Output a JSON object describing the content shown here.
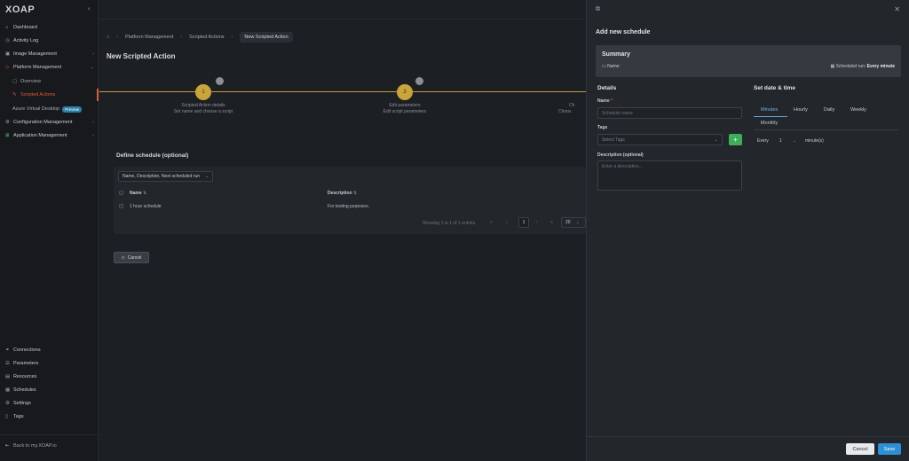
{
  "sidebar": {
    "logo": "XOAP",
    "items": [
      {
        "label": "Dashboard",
        "icon": "⌂"
      },
      {
        "label": "Activity Log",
        "icon": "◷"
      },
      {
        "label": "Image Management",
        "icon": "▣"
      },
      {
        "label": "Platform Management",
        "icon": "◇"
      },
      {
        "label": "Overview",
        "icon": "▢"
      },
      {
        "label": "Scripted Actions",
        "icon": "✎"
      },
      {
        "label": "Azure Virtual Desktop",
        "badge": "Preview"
      },
      {
        "label": "Configuration Management",
        "icon": "⚙"
      },
      {
        "label": "Application Management",
        "icon": "⊞"
      }
    ],
    "bottom_items": [
      {
        "label": "Connections",
        "icon": "⚭"
      },
      {
        "label": "Parameters",
        "icon": "☰"
      },
      {
        "label": "Resources",
        "icon": "▤"
      },
      {
        "label": "Schedules",
        "icon": "▦"
      },
      {
        "label": "Settings",
        "icon": "⚙"
      },
      {
        "label": "Tags",
        "icon": "▯"
      }
    ],
    "back_link": "Back to my.XOAP.io"
  },
  "main": {
    "breadcrumb": [
      "Platform Management",
      "Scripted Actions",
      "New Scripted Action"
    ],
    "title": "New Scripted Action",
    "steps": [
      {
        "number": "1",
        "title": "Scripted Action details",
        "subtitle": "Set name and choose a script"
      },
      {
        "number": "2",
        "title": "Edit parameters",
        "subtitle": "Edit script parameters"
      },
      {
        "title": "Ch",
        "subtitle": "Choos"
      }
    ],
    "section_title": "Define schedule (optional)",
    "column_select": "Name, Description, Next scheduled run",
    "table": {
      "headers": [
        "Name",
        "Description"
      ],
      "rows": [
        {
          "name": "1 hour schedule",
          "description": "For testing purposes."
        }
      ]
    },
    "pagination": {
      "summary": "Showing 1 to 1 of 1 entries",
      "current_page": "1",
      "page_size": "20"
    },
    "cancel_label": "Cancel"
  },
  "drawer": {
    "title": "Add new schedule",
    "summary": {
      "title": "Summary",
      "name_label": "Name:",
      "run_label": "Scheduled run:",
      "run_value": "Every minute"
    },
    "details": {
      "heading": "Details",
      "name_label": "Name",
      "name_placeholder": "Schedule name",
      "tags_label": "Tags",
      "tags_placeholder": "Select Tags",
      "description_label": "Description (optional)",
      "description_placeholder": "Enter a description..."
    },
    "datetime": {
      "heading": "Set date & time",
      "tabs": [
        "Minutes",
        "Hourly",
        "Daily",
        "Weekly",
        "Monthly"
      ],
      "every_label": "Every",
      "every_value": "1",
      "unit": "minute(s)"
    },
    "cancel_label": "Cancel",
    "save_label": "Save"
  },
  "colors": {
    "accent_orange": "#e05a3a",
    "step_gold": "#c9a43a",
    "save_blue": "#2d8fd5",
    "add_green": "#3fae5a",
    "tab_blue": "#6fb6e6"
  }
}
